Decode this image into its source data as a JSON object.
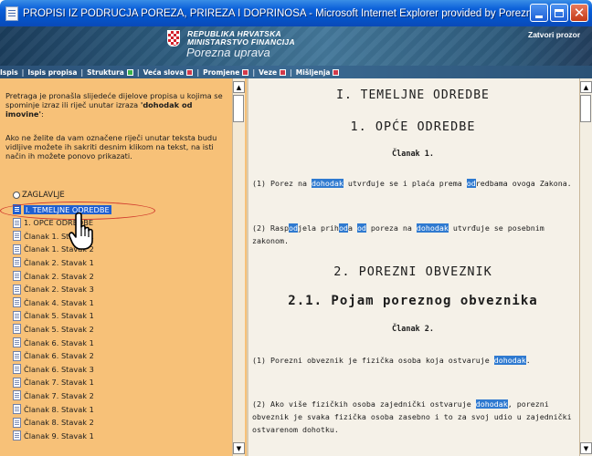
{
  "window": {
    "title": "PROPISI IZ PODRUČJA POREZA, PRIREZA I DOPRINOSA - Microsoft Internet Explorer provided by Porezna ..."
  },
  "banner": {
    "line1": "REPUBLIKA HRVATSKA",
    "line2": "MINISTARSTVO FINANCIJA",
    "line3": "Porezna uprava",
    "close_link": "Zatvori prozor"
  },
  "nav": {
    "items": [
      {
        "label": "Ispis",
        "flag": ""
      },
      {
        "label": "Ispis propisa",
        "flag": ""
      },
      {
        "label": "Struktura",
        "flag": "green"
      },
      {
        "label": "Veća slova",
        "flag": "red"
      },
      {
        "label": "Promjene",
        "flag": "red"
      },
      {
        "label": "Veze",
        "flag": "red"
      },
      {
        "label": "Mišljenja",
        "flag": "red"
      }
    ]
  },
  "left": {
    "intro_text": "Pretraga je pronašla slijedeće dijelove propisa u kojima se spominje izraz ili riječ unutar izraza ",
    "intro_term": "'dohodak od imovine'",
    "intro_end": ":",
    "hint": "Ako ne želite da vam označene riječi unutar teksta budu vidljive možete ih sakriti desnim klikom na tekst, na isti način ih možete ponovo prikazati.",
    "tree_root": "ZAGLAVLJE",
    "tree_items": [
      {
        "label": "I. TEMELJNE ODREDBE",
        "selected": true
      },
      {
        "label": "1. OPĆE ODREDBE",
        "selected": false
      },
      {
        "label": "Članak 1. Stavak 1",
        "selected": false
      },
      {
        "label": "Članak 1. Stavak 2",
        "selected": false
      },
      {
        "label": "Članak 2. Stavak 1",
        "selected": false
      },
      {
        "label": "Članak 2. Stavak 2",
        "selected": false
      },
      {
        "label": "Članak 2. Stavak 3",
        "selected": false
      },
      {
        "label": "Članak 4. Stavak 1",
        "selected": false
      },
      {
        "label": "Članak 5. Stavak 1",
        "selected": false
      },
      {
        "label": "Članak 5. Stavak 2",
        "selected": false
      },
      {
        "label": "Članak 6. Stavak 1",
        "selected": false
      },
      {
        "label": "Članak 6. Stavak 2",
        "selected": false
      },
      {
        "label": "Članak 6. Stavak 3",
        "selected": false
      },
      {
        "label": "Članak 7. Stavak 1",
        "selected": false
      },
      {
        "label": "Članak 7. Stavak 2",
        "selected": false
      },
      {
        "label": "Članak 8. Stavak 1",
        "selected": false
      },
      {
        "label": "Članak 8. Stavak 2",
        "selected": false
      },
      {
        "label": "Članak 9. Stavak 1",
        "selected": false
      }
    ]
  },
  "document": {
    "h_part": "I. TEMELJNE ODREDBE",
    "h_section1": "1. OPĆE ODREDBE",
    "clanak1": "Članak 1.",
    "para1": [
      {
        "t": "(1) Porez na ",
        "hl": false
      },
      {
        "t": "dohodak",
        "hl": true
      },
      {
        "t": " utvrđuje se i plaća prema ",
        "hl": false
      },
      {
        "t": "od",
        "hl": true
      },
      {
        "t": "redbama ovoga Zakona.",
        "hl": false
      }
    ],
    "para2": [
      {
        "t": "(2) Rasp",
        "hl": false
      },
      {
        "t": "od",
        "hl": true
      },
      {
        "t": "jela prih",
        "hl": false
      },
      {
        "t": "od",
        "hl": true
      },
      {
        "t": "a ",
        "hl": false
      },
      {
        "t": "od",
        "hl": true
      },
      {
        "t": " poreza na ",
        "hl": false
      },
      {
        "t": "dohodak",
        "hl": true
      },
      {
        "t": " utvrđuje se posebnim zakonom.",
        "hl": false
      }
    ],
    "h_section2": "2. POREZNI OBVEZNIK",
    "h_sub": "2.1. Pojam poreznog obveznika",
    "clanak2": "Članak 2.",
    "para3": [
      {
        "t": "(1) Porezni obveznik je fizička osoba koja ostvaruje ",
        "hl": false
      },
      {
        "t": "dohodak",
        "hl": true
      },
      {
        "t": ".",
        "hl": false
      }
    ],
    "para4": [
      {
        "t": "(2) Ako više fizičkih osoba zajednički ostvaruje ",
        "hl": false
      },
      {
        "t": "dohodak",
        "hl": true
      },
      {
        "t": ", porezni obveznik je svaka fizička osoba zasebno i to za svoj udio u zajednički ostvarenom dohotku.",
        "hl": false
      }
    ]
  }
}
